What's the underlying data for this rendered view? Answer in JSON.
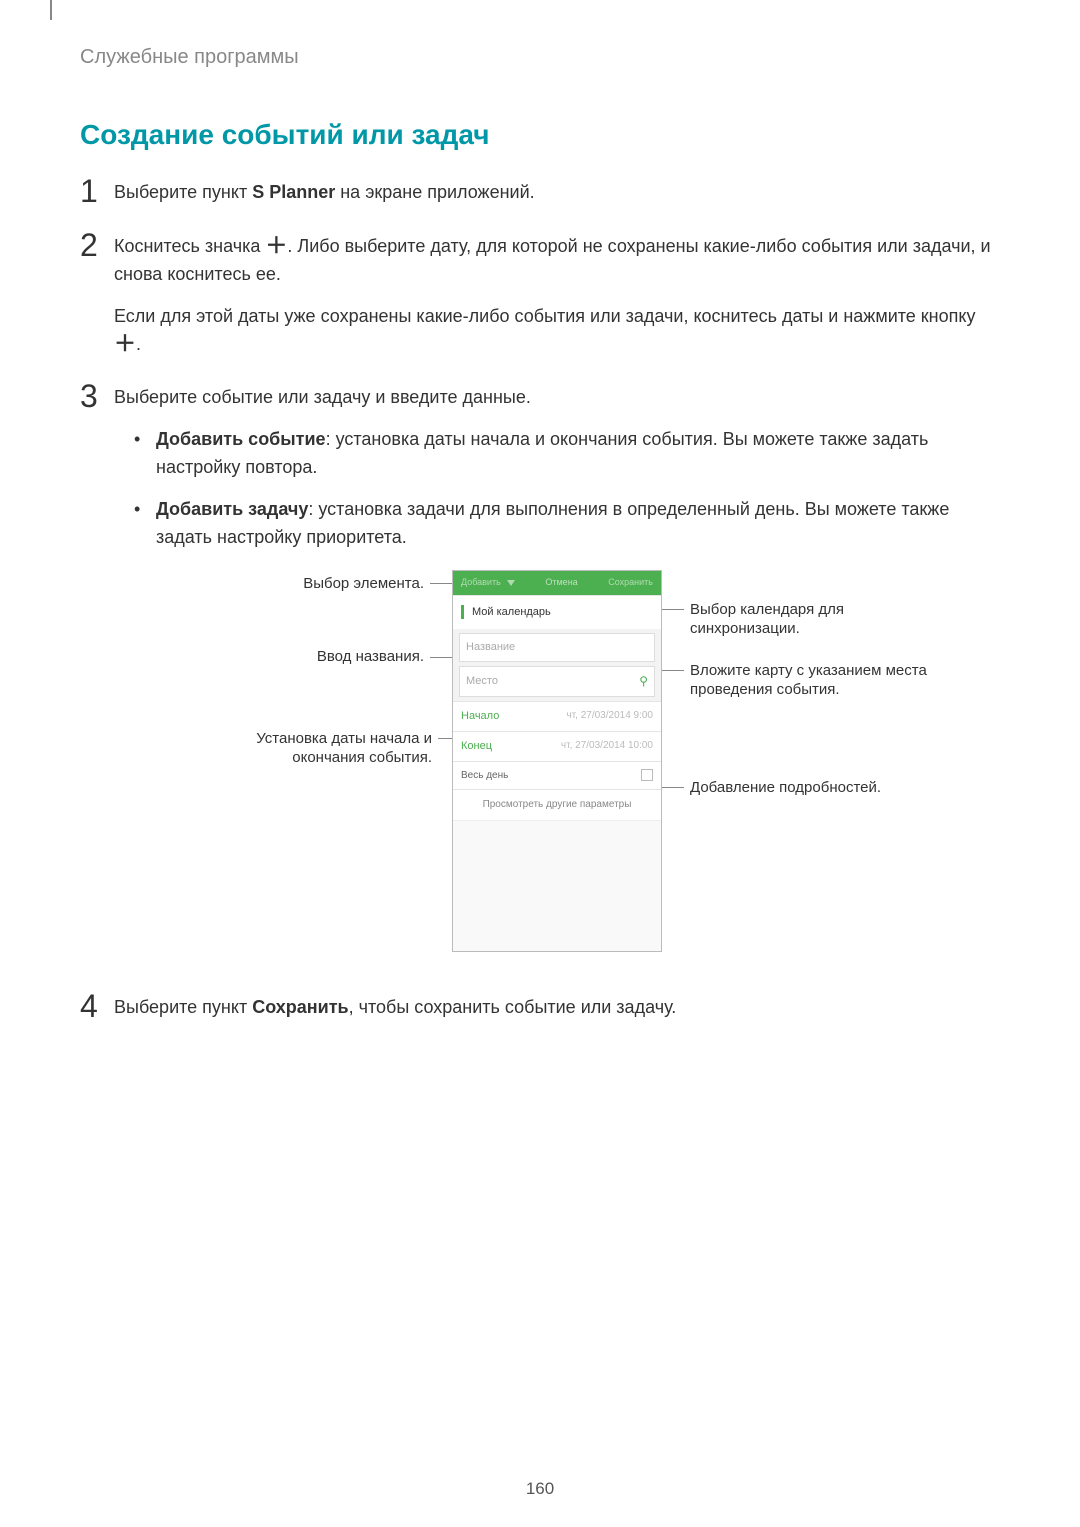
{
  "breadcrumb": "Служебные программы",
  "section_title": "Создание событий или задач",
  "steps": {
    "s1": {
      "num": "1",
      "pre": "Выберите пункт ",
      "bold": "S Planner",
      "post": " на экране приложений."
    },
    "s2": {
      "num": "2",
      "p1_pre": "Коснитесь значка ",
      "p1_post": ". Либо выберите дату, для которой не сохранены какие-либо события или задачи, и снова коснитесь ее.",
      "p2_pre": "Если для этой даты уже сохранены какие-либо события или задачи, коснитесь даты и нажмите кнопку ",
      "p2_post": "."
    },
    "s3": {
      "num": "3",
      "intro": "Выберите событие или задачу и введите данные.",
      "b1_bold": "Добавить событие",
      "b1_rest": ": установка даты начала и окончания события. Вы можете также задать настройку повтора.",
      "b2_bold": "Добавить задачу",
      "b2_rest": ": установка задачи для выполнения в определенный день. Вы можете также задать настройку приоритета."
    },
    "s4": {
      "num": "4",
      "pre": "Выберите пункт ",
      "bold": "Сохранить",
      "post": ", чтобы сохранить событие или задачу."
    }
  },
  "callouts": {
    "left1": "Выбор элемента.",
    "left2": "Ввод названия.",
    "left3": "Установка даты начала и окончания события.",
    "right1": "Выбор календаря для синхронизации.",
    "right2": "Вложите карту с указанием места проведения события.",
    "right3": "Добавление подробностей."
  },
  "phone": {
    "hdr_left": "Добавить",
    "hdr_mid": "Отмена",
    "hdr_right": "Сохранить",
    "calendar": "Мой календарь",
    "title_ph": "Название",
    "place_ph": "Место",
    "start_lbl": "Начало",
    "start_val": "чт, 27/03/2014   9:00",
    "end_lbl": "Конец",
    "end_val": "чт, 27/03/2014   10:00",
    "allday": "Весь день",
    "more": "Просмотреть другие параметры"
  },
  "page_number": "160"
}
